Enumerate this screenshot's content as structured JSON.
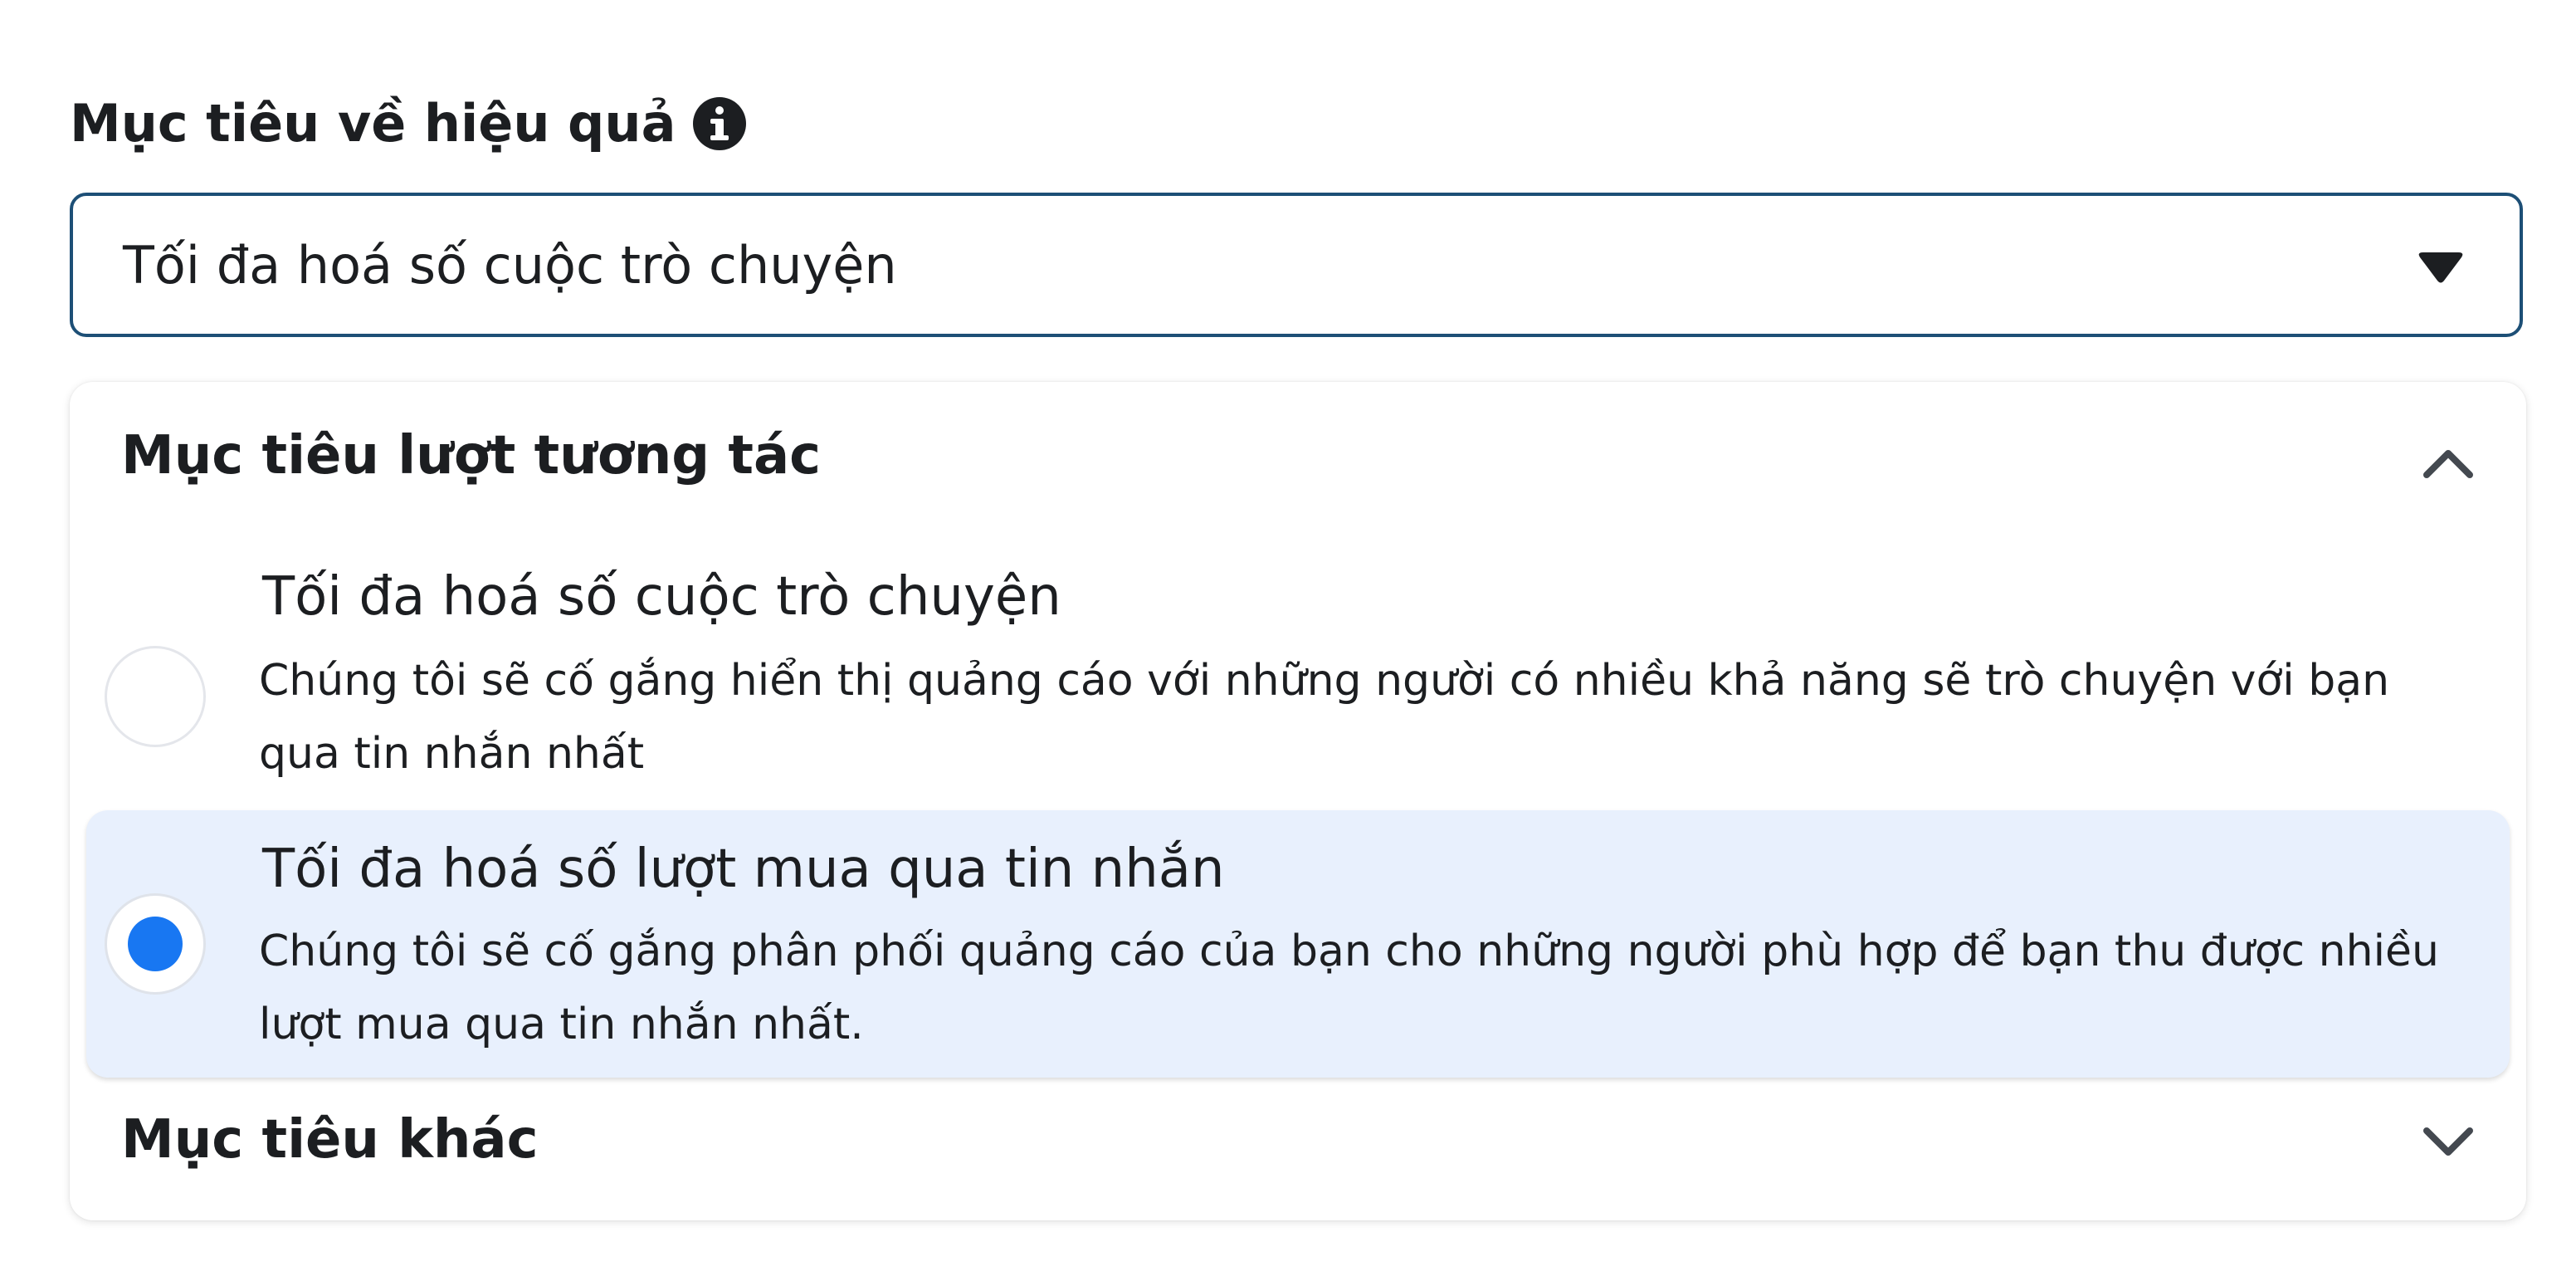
{
  "performance_goal": {
    "label": "Mục tiêu về hiệu quả",
    "selected_value": "Tối đa hoá số cuộc trò chuyện"
  },
  "groups": {
    "engagement": {
      "title": "Mục tiêu lượt tương tác",
      "expanded": true,
      "options": [
        {
          "title": "Tối đa hoá số cuộc trò chuyện",
          "description": "Chúng tôi sẽ cố gắng hiển thị quảng cáo với những người có nhiều khả năng sẽ trò chuyện với bạn qua tin nhắn nhất",
          "selected": false
        },
        {
          "title": "Tối đa hoá số lượt mua qua tin nhắn",
          "description": "Chúng tôi sẽ cố gắng phân phối quảng cáo của bạn cho những người phù hợp để bạn thu được nhiều lượt mua qua tin nhắn nhất.",
          "selected": true
        }
      ]
    },
    "other": {
      "title": "Mục tiêu khác",
      "expanded": false
    }
  },
  "icons": {
    "info": "info-icon",
    "dropdown": "caret-down-icon",
    "collapse": "chevron-up-icon",
    "expand": "chevron-down-icon"
  },
  "colors": {
    "select_border": "#1d4f76",
    "selected_option_bg": "#e8f0fd",
    "radio_selected": "#1877f2",
    "text": "#1c1e21"
  }
}
